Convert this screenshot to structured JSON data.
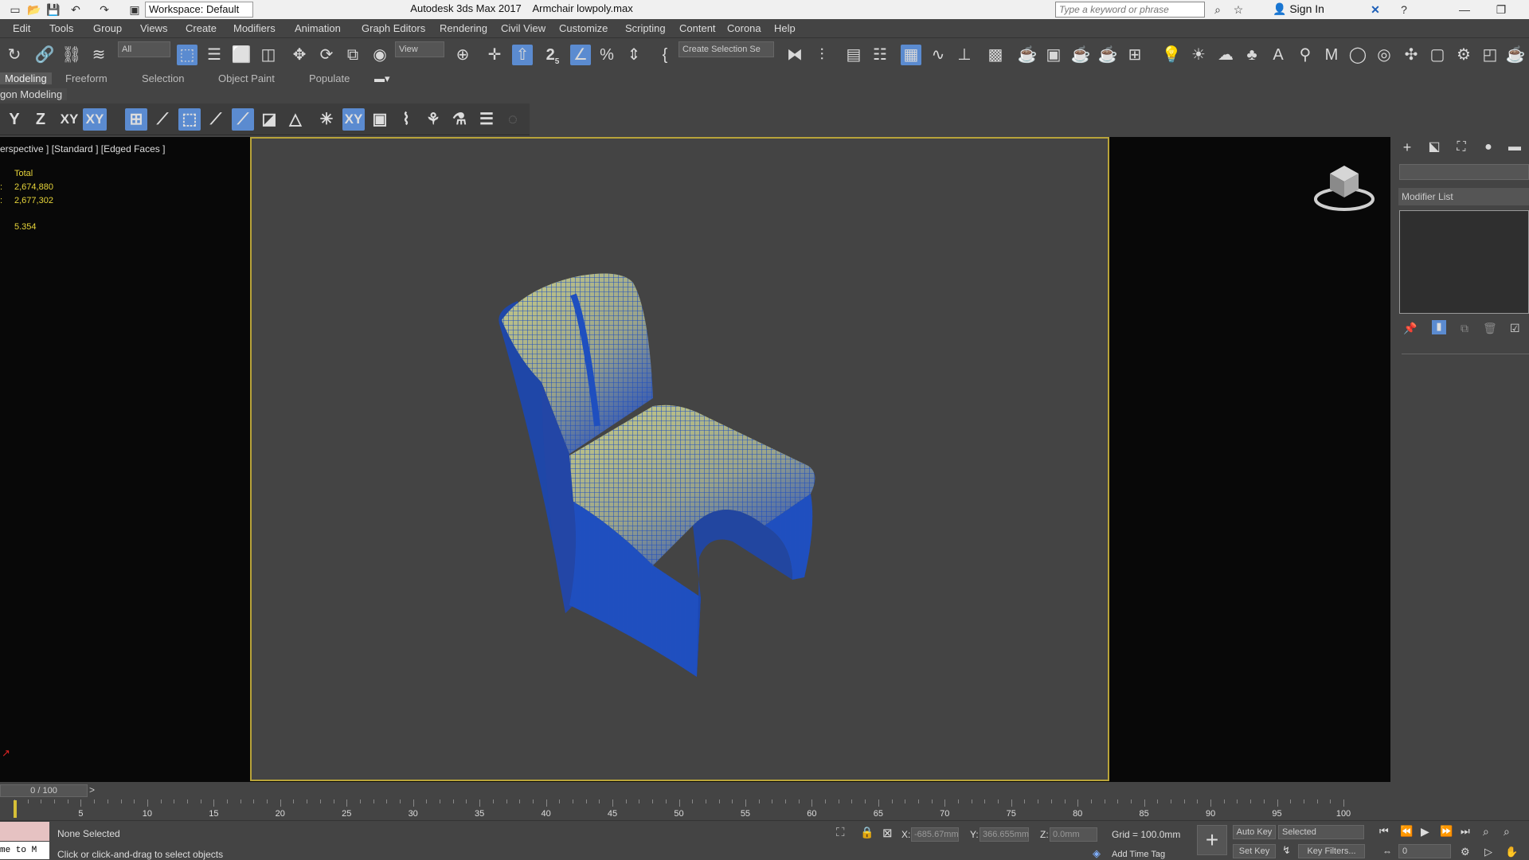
{
  "titlebar": {
    "workspace": "Workspace: Default",
    "app_title": "Autodesk 3ds Max 2017",
    "file_name": "Armchair lowpoly.max",
    "search_placeholder": "Type a keyword or phrase",
    "sign_in": "Sign In"
  },
  "menu": [
    "Edit",
    "Tools",
    "Group",
    "Views",
    "Create",
    "Modifiers",
    "Animation",
    "Graph Editors",
    "Rendering",
    "Civil View",
    "Customize",
    "Scripting",
    "Content",
    "Corona",
    "Help"
  ],
  "toolbar": {
    "selection_filter": "All",
    "ref_coord": "View",
    "selection_set": "Create Selection Se",
    "snap_label": "2",
    "snap_sub": "5"
  },
  "ribbon": {
    "tabs": [
      "Modeling",
      "Freeform",
      "Selection",
      "Object Paint",
      "Populate"
    ],
    "panel": "gon Modeling"
  },
  "graphite": [
    "Y",
    "Z",
    "XY",
    "XY"
  ],
  "viewport": {
    "label": "erspective ] [Standard ] [Edged Faces ]",
    "stats": {
      "total": "Total",
      "polys": "2,674,880",
      "verts": "2,677,302",
      "fps": "5.354",
      "prefix1": ":",
      "prefix2": ":"
    }
  },
  "command_panel": {
    "modifier_list": "Modifier List"
  },
  "timeline": {
    "frame": "0 / 100",
    "ticks": [
      5,
      10,
      15,
      20,
      25,
      30,
      35,
      40,
      45,
      50,
      55,
      60,
      65,
      70,
      75,
      80,
      85,
      90,
      95,
      100
    ]
  },
  "status": {
    "script_listener": "me to M",
    "selection": "None Selected",
    "prompt": "Click or click-and-drag to select objects",
    "x_label": "X:",
    "x_value": "-685.67mm",
    "y_label": "Y:",
    "y_value": "366.655mm",
    "z_label": "Z:",
    "z_value": "0.0mm",
    "grid": "Grid = 100.0mm",
    "add_time_tag": "Add Time Tag",
    "auto_key": "Auto Key",
    "set_key": "Set Key",
    "selected": "Selected",
    "key_filters": "Key Filters...",
    "frame_value": "0"
  },
  "colors": {
    "viewport_border": "#b8a33a",
    "stats_text": "#e7d53a",
    "highlight": "#5b8bd0",
    "chair_mesh": "#1f4fbf"
  }
}
